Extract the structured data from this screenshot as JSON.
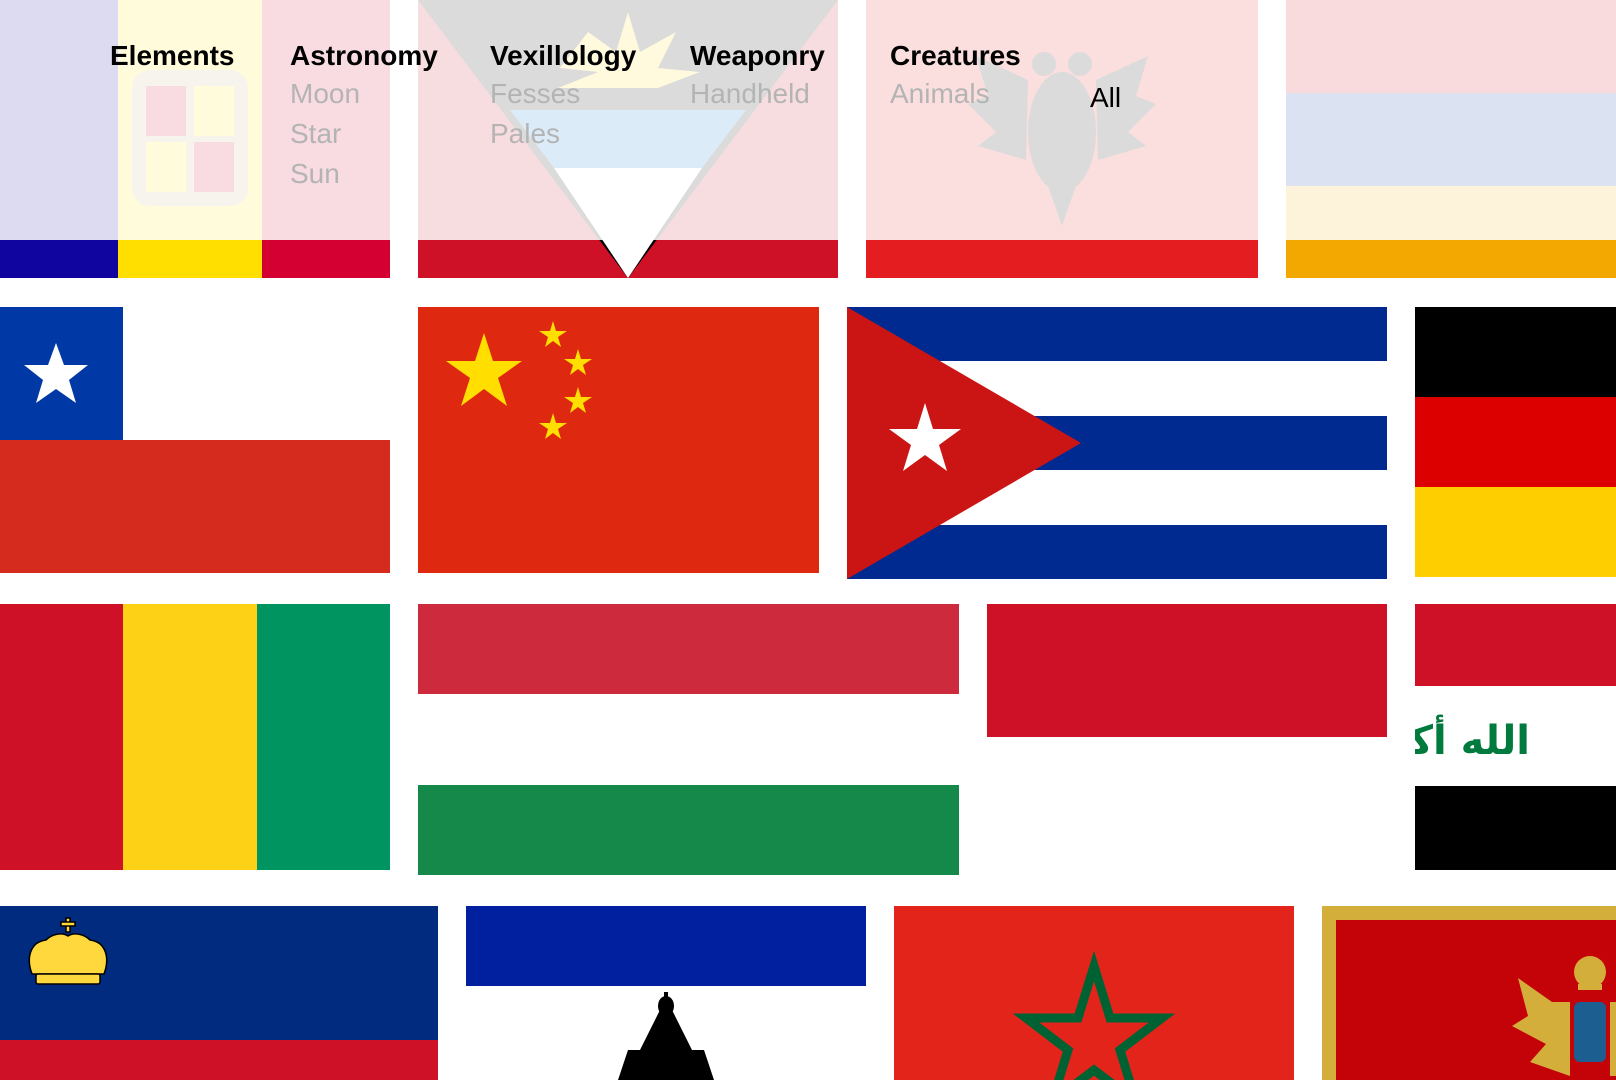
{
  "menu": {
    "categories": [
      {
        "title": "Elements",
        "items": []
      },
      {
        "title": "Astronomy",
        "items": [
          "Moon",
          "Star",
          "Sun"
        ]
      },
      {
        "title": "Vexillology",
        "items": [
          "Fesses",
          "Pales"
        ]
      },
      {
        "title": "Weaponry",
        "items": [
          "Handheld"
        ]
      },
      {
        "title": "Creatures",
        "items": [
          "Animals"
        ]
      }
    ],
    "all_label": "All"
  },
  "flags": {
    "row1": [
      "Andorra",
      "Antigua and Barbuda",
      "Albania",
      "Armenia"
    ],
    "row2": [
      "Chile",
      "China",
      "Cuba",
      "Germany"
    ],
    "row3": [
      "Guinea",
      "Hungary",
      "Indonesia",
      "Iraq"
    ],
    "row4": [
      "Liechtenstein",
      "Lesotho",
      "Morocco",
      "Montenegro"
    ]
  },
  "iraq_inscription": "الله أكبر",
  "colors": {
    "red": "#d21034",
    "china_red": "#de2910",
    "china_yellow": "#ffde00",
    "cuba_blue": "#002a8f",
    "hungary_green": "#15894a",
    "guinea_green": "#009460",
    "liechtenstein_blue": "#002b7f",
    "lesotho_blue": "#00209f",
    "morocco_red": "#e3241b",
    "morocco_green": "#006233",
    "montenegro_gold": "#d3ae3b"
  }
}
